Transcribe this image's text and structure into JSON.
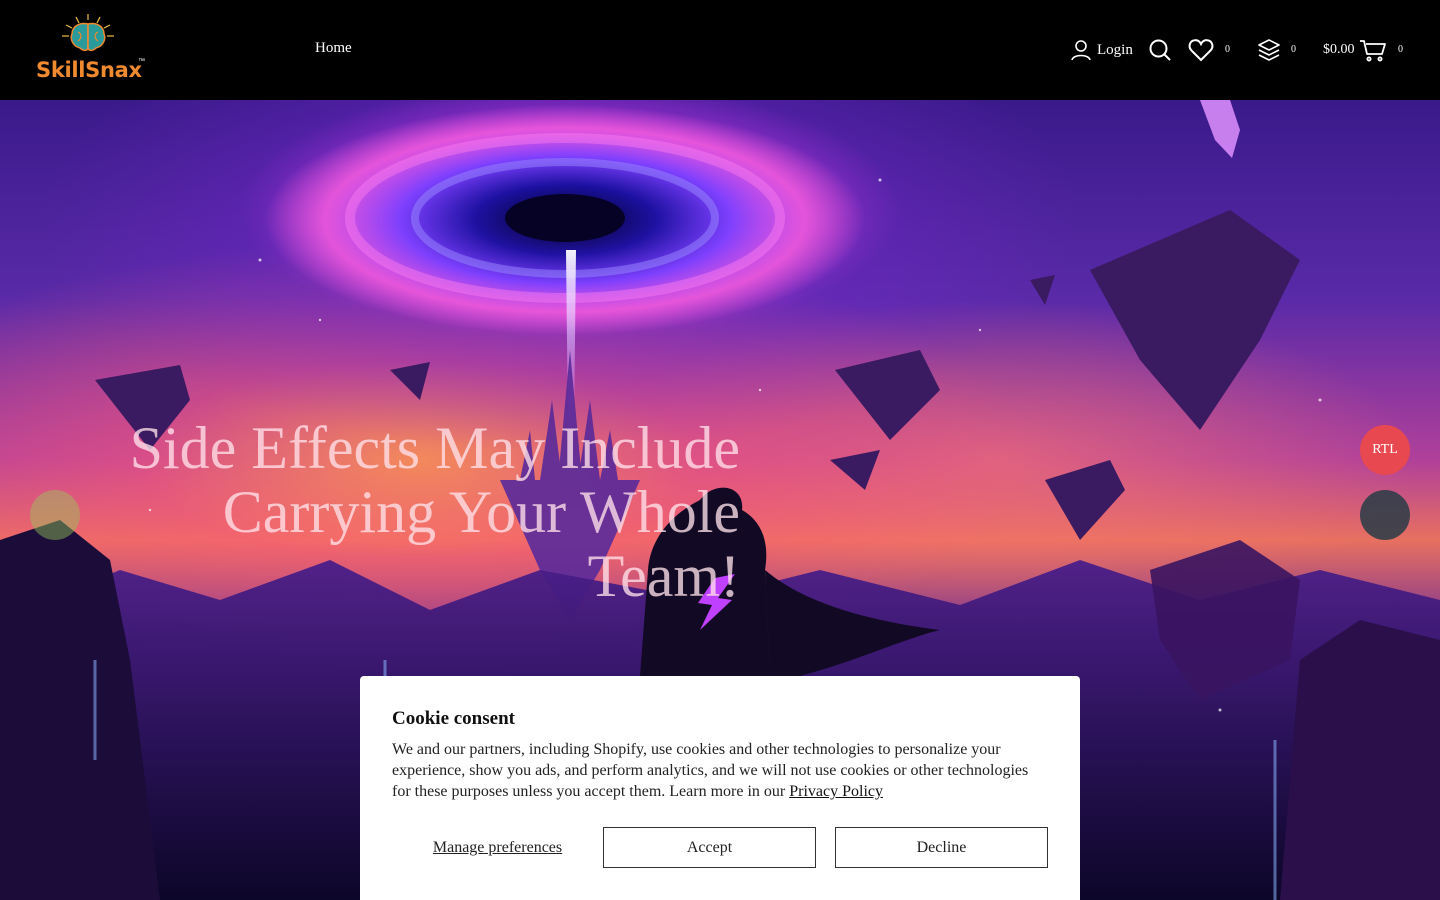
{
  "header": {
    "brand": "SkillSnax",
    "trademark": "™",
    "nav": {
      "home": "Home"
    },
    "login_label": "Login",
    "wishlist_count": "0",
    "compare_count": "0",
    "cart_total": "$0.00",
    "cart_count": "0"
  },
  "hero": {
    "title": "Side Effects May Include Carrying Your Whole Team!"
  },
  "side_buttons": {
    "rtl_label": "RTL"
  },
  "cookie": {
    "title": "Cookie consent",
    "text": "We and our partners, including Shopify, use cookies and other technologies to personalize your experience, show you ads, and perform analytics, and we will not use cookies or other technologies for these purposes unless you accept them. Learn more in our ",
    "link_label": "Privacy Policy",
    "manage_label": "Manage preferences",
    "accept_label": "Accept",
    "decline_label": "Decline"
  },
  "colors": {
    "header_bg": "#000000",
    "brand_orange": "#f08a2e",
    "rtl_red": "#e8484f"
  },
  "icons": [
    "brain-logo-icon",
    "user-icon",
    "search-icon",
    "heart-icon",
    "layers-icon",
    "cart-icon"
  ]
}
